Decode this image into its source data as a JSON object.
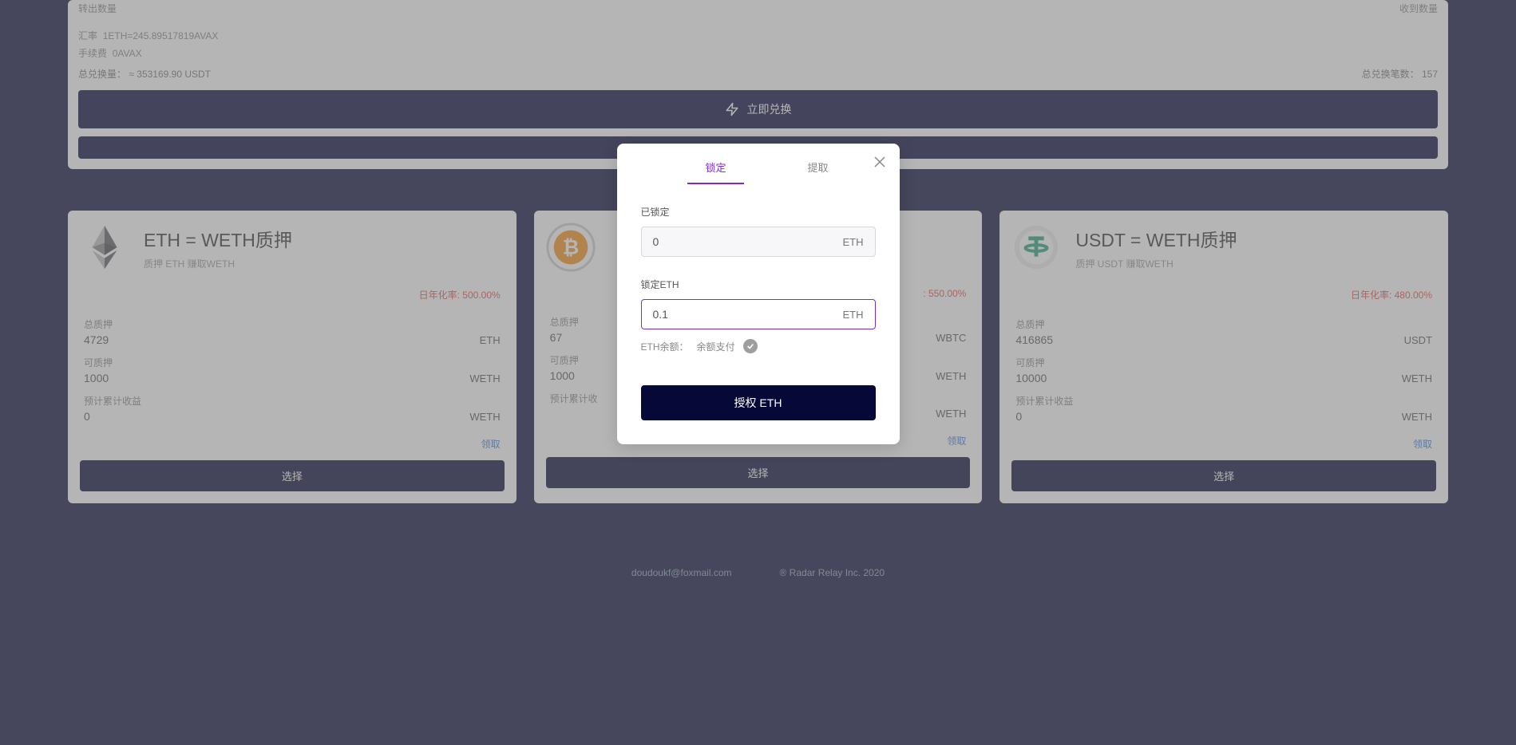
{
  "exchange": {
    "out_label": "转出数量",
    "in_label": "收到数量",
    "rate_label": "汇率",
    "rate_value": "1ETH=245.89517819AVAX",
    "fee_label": "手续费",
    "fee_value": "0AVAX",
    "total_swap_label": "总兑换量：",
    "total_swap_value": "≈ 353169.90 USDT",
    "total_count_label": "总兑换笔数：",
    "total_count_value": "157",
    "swap_now_btn": "立即兑换",
    "secondary_btn": ""
  },
  "cards": [
    {
      "icon": "eth",
      "title": "ETH  =  WETH质押",
      "subtitle": "质押 ETH 赚取WETH",
      "apr": "日年化率: 500.00%",
      "total_stake_label": "总质押",
      "total_stake_value": "4729",
      "total_stake_unit": "ETH",
      "available_label": "可质押",
      "available_value": "1000",
      "available_unit": "WETH",
      "est_label": "预计累计收益",
      "est_value": "0",
      "est_unit": "WETH",
      "claim": "领取",
      "select": "选择"
    },
    {
      "icon": "wbtc",
      "title": "",
      "subtitle": "",
      "apr": ": 550.00%",
      "total_stake_label": "总质押",
      "total_stake_value": "67",
      "total_stake_unit": "WBTC",
      "available_label": "可质押",
      "available_value": "1000",
      "available_unit": "WETH",
      "est_label": "预计累计收",
      "est_value": "",
      "est_unit": "WETH",
      "claim": "领取",
      "select": "选择"
    },
    {
      "icon": "usdt",
      "title": "USDT  =  WETH质押",
      "subtitle": "质押 USDT 赚取WETH",
      "apr": "日年化率: 480.00%",
      "total_stake_label": "总质押",
      "total_stake_value": "416865",
      "total_stake_unit": "USDT",
      "available_label": "可质押",
      "available_value": "10000",
      "available_unit": "WETH",
      "est_label": "预计累计收益",
      "est_value": "0",
      "est_unit": "WETH",
      "claim": "领取",
      "select": "选择"
    }
  ],
  "footer": {
    "email": "doudoukf@foxmail.com",
    "copyright": "® Radar Relay Inc. 2020"
  },
  "modal": {
    "tab_lock": "锁定",
    "tab_withdraw": "提取",
    "locked_label": "已锁定",
    "locked_value": "0",
    "locked_unit": "ETH",
    "lock_label": "锁定ETH",
    "lock_value": "0.1",
    "lock_unit": "ETH",
    "balance_label": "ETH余额：",
    "balance_pay": "余额支付",
    "submit": "授权 ETH"
  }
}
